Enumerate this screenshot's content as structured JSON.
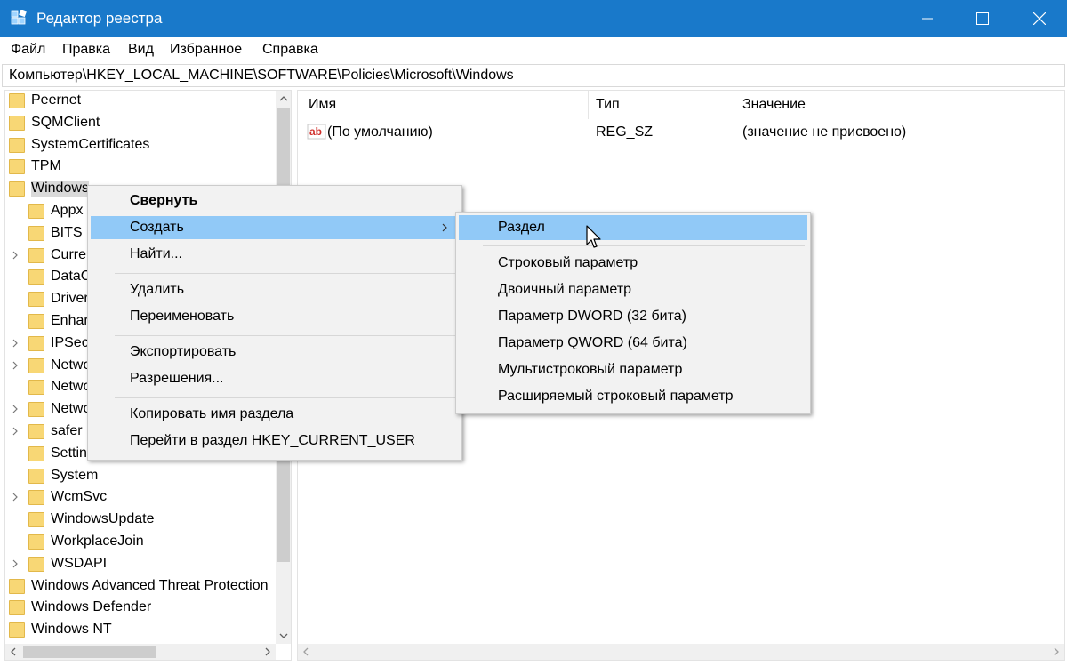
{
  "window": {
    "title": "Редактор реестра",
    "accent_color": "#1979ca",
    "app_icon": "registry-editor-icon"
  },
  "menubar": {
    "items": [
      "Файл",
      "Правка",
      "Вид",
      "Избранное",
      "Справка"
    ]
  },
  "address": {
    "path": "Компьютер\\HKEY_LOCAL_MACHINE\\SOFTWARE\\Policies\\Microsoft\\Windows"
  },
  "tree": {
    "items": [
      {
        "label": "Peernet",
        "expandable": false
      },
      {
        "label": "SQMClient",
        "expandable": false
      },
      {
        "label": "SystemCertificates",
        "expandable": false
      },
      {
        "label": "TPM",
        "expandable": false
      },
      {
        "label": "Windows",
        "expandable": false,
        "selected": true
      },
      {
        "label": "Appx",
        "expandable": false
      },
      {
        "label": "BITS",
        "expandable": false
      },
      {
        "label": "Curre",
        "expandable": true
      },
      {
        "label": "DataC",
        "expandable": false
      },
      {
        "label": "Driver",
        "expandable": false
      },
      {
        "label": "Enhar",
        "expandable": false
      },
      {
        "label": "IPSec",
        "expandable": true
      },
      {
        "label": "Netwo",
        "expandable": true
      },
      {
        "label": "Netwo",
        "expandable": false
      },
      {
        "label": "Netwo",
        "expandable": true
      },
      {
        "label": "safer",
        "expandable": true
      },
      {
        "label": "Setting",
        "expandable": false
      },
      {
        "label": "System",
        "expandable": false
      },
      {
        "label": "WcmSvc",
        "expandable": true
      },
      {
        "label": "WindowsUpdate",
        "expandable": false
      },
      {
        "label": "WorkplaceJoin",
        "expandable": false
      },
      {
        "label": "WSDAPI",
        "expandable": true
      },
      {
        "label": "Windows Advanced Threat Protection",
        "expandable": false
      },
      {
        "label": "Windows Defender",
        "expandable": false
      },
      {
        "label": "Windows NT",
        "expandable": false
      }
    ]
  },
  "list": {
    "columns": {
      "name": "Имя",
      "type": "Тип",
      "value": "Значение"
    },
    "rows": [
      {
        "name": "(По умолчанию)",
        "type": "REG_SZ",
        "value": "(значение не присвоено)",
        "icon": "string-value-icon"
      }
    ]
  },
  "context_menu": {
    "items": [
      {
        "label": "Свернуть",
        "bold": true
      },
      {
        "label": "Создать",
        "has_submenu": true,
        "highlighted": true
      },
      {
        "label": "Найти..."
      },
      {
        "label": "Удалить"
      },
      {
        "label": "Переименовать"
      },
      {
        "label": "Экспортировать"
      },
      {
        "label": "Разрешения..."
      },
      {
        "label": "Копировать имя раздела"
      },
      {
        "label": "Перейти в раздел HKEY_CURRENT_USER"
      }
    ],
    "highlight_color": "#91c9f7"
  },
  "submenu": {
    "items": [
      {
        "label": "Раздел",
        "highlighted": true
      },
      {
        "label": "Строковый параметр"
      },
      {
        "label": "Двоичный параметр"
      },
      {
        "label": "Параметр DWORD (32 бита)"
      },
      {
        "label": "Параметр QWORD (64 бита)"
      },
      {
        "label": "Мультистроковый параметр"
      },
      {
        "label": "Расширяемый строковый параметр"
      }
    ]
  }
}
